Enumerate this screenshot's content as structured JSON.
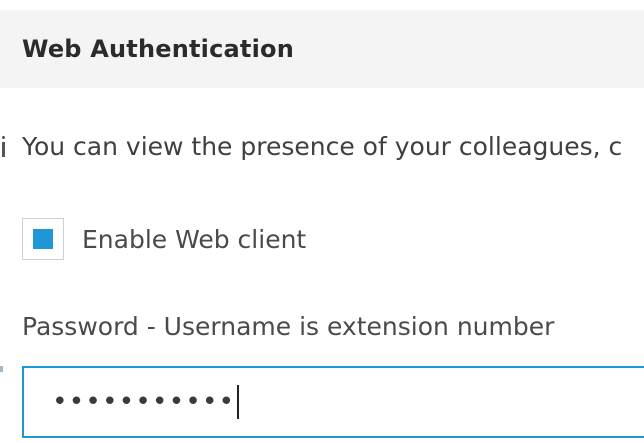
{
  "section": {
    "title": "Web Authentication"
  },
  "info": {
    "icon": "info-icon",
    "text": "You can view the presence of your colleagues, c"
  },
  "web_client": {
    "label": "Enable Web client",
    "checked": true,
    "check_color": "#1f97d4"
  },
  "password": {
    "label": "Password - Username is extension number",
    "value": "•••••••••••",
    "focused": true,
    "focus_color": "#1f97d4"
  }
}
